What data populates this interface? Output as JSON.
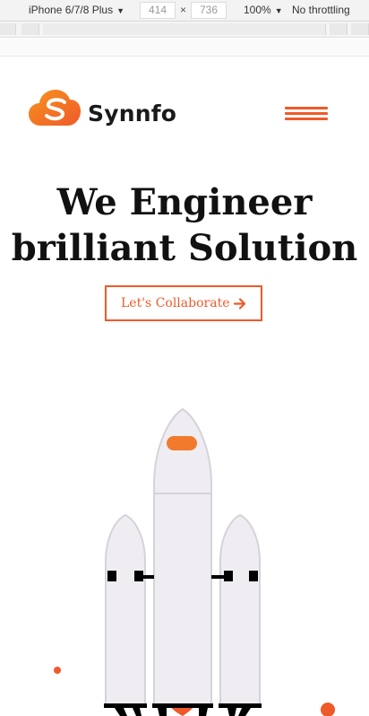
{
  "devtools": {
    "device": "iPhone 6/7/8 Plus",
    "width": "414",
    "times": "×",
    "height": "736",
    "zoom": "100%",
    "throttling": "No throttling"
  },
  "site": {
    "brand": "Synnfo",
    "hero": {
      "line1": "We Engineer",
      "line2": "brilliant Solution"
    },
    "cta_label": "Let's Collaborate"
  },
  "colors": {
    "accent": "#ef5a2a",
    "logo_gradient_start": "#f7931e",
    "logo_gradient_end": "#ef5a2a",
    "rocket_body": "#efedf2",
    "rocket_outline": "#d6d2da",
    "window": "#f27a2c"
  },
  "icons": {
    "logo": "cloud-s-icon",
    "menu": "hamburger-icon",
    "cta": "arrow-right-icon"
  }
}
